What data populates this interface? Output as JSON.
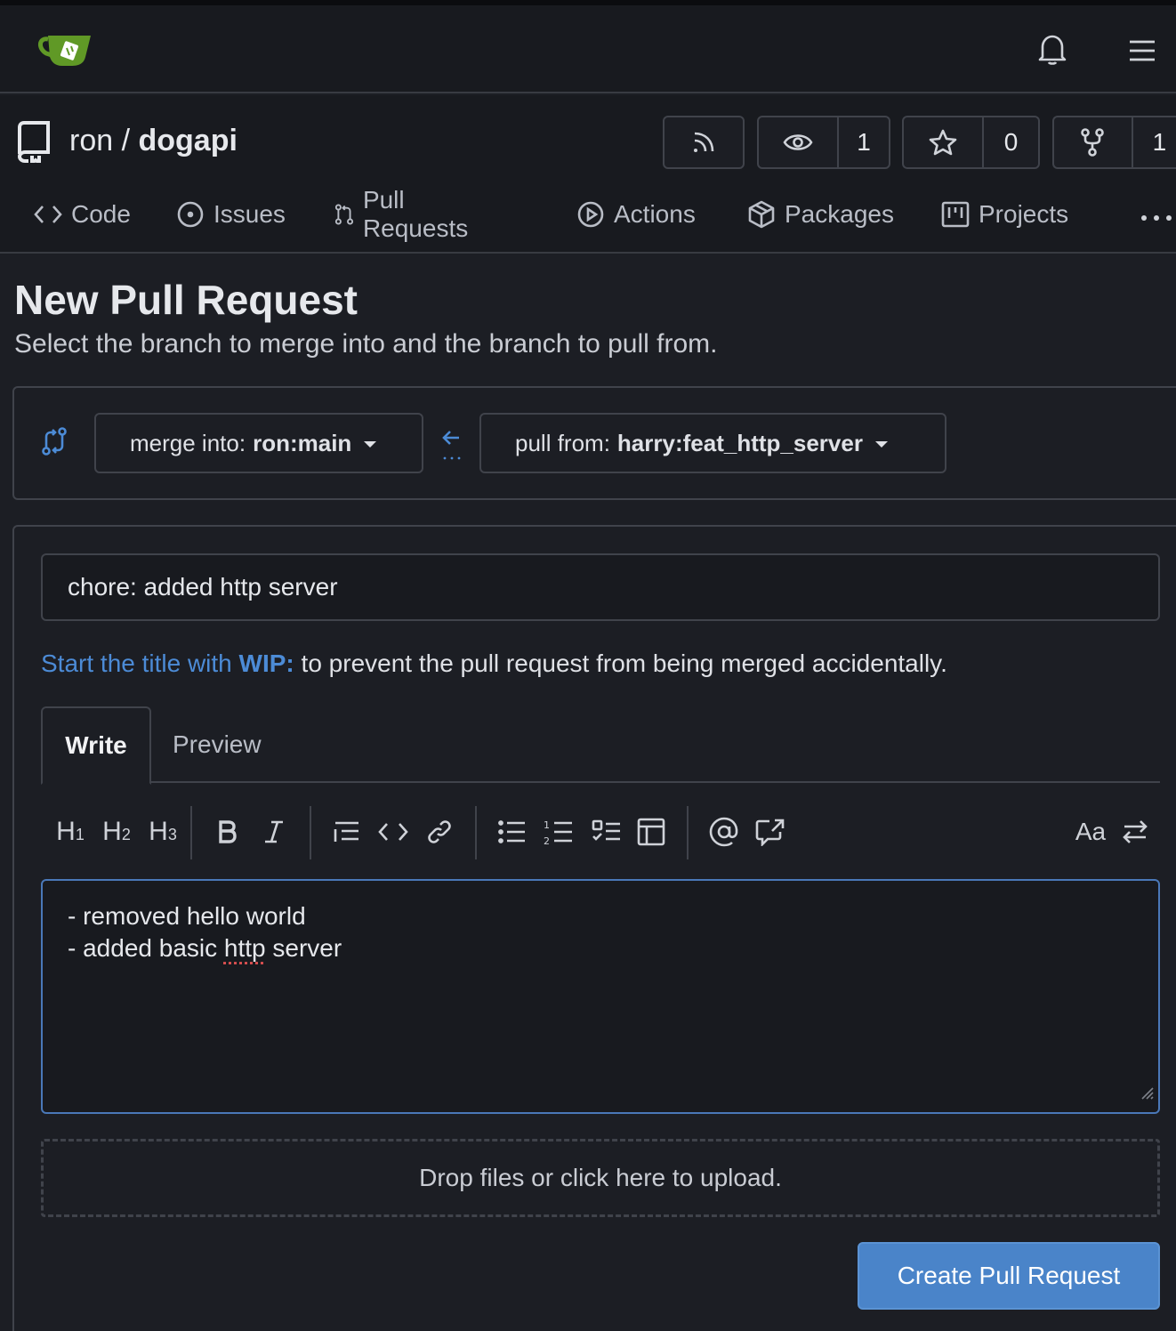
{
  "header": {
    "logo": "gitea-logo",
    "icons": [
      "bell-icon",
      "hamburger-menu-icon"
    ]
  },
  "repo": {
    "owner": "ron",
    "separator": "/",
    "name": "dogapi",
    "watch_count": "1",
    "star_count": "0",
    "fork_count": "1"
  },
  "tabs": [
    {
      "label": "Code",
      "icon": "code-icon"
    },
    {
      "label": "Issues",
      "icon": "issue-icon"
    },
    {
      "label": "Pull Requests",
      "icon": "pull-request-icon"
    },
    {
      "label": "Actions",
      "icon": "play-icon"
    },
    {
      "label": "Packages",
      "icon": "package-icon"
    },
    {
      "label": "Projects",
      "icon": "project-icon"
    }
  ],
  "page": {
    "title": "New Pull Request",
    "subtitle": "Select the branch to merge into and the branch to pull from."
  },
  "branches": {
    "merge_prefix": "merge into:",
    "merge_value": "ron:main",
    "pull_prefix": "pull from:",
    "pull_value": "harry:feat_http_server"
  },
  "form": {
    "title_value": "chore: added http server",
    "wip_link_prefix": "Start the title with",
    "wip_keyword": "WIP:",
    "wip_rest": "to prevent the pull request from being merged accidentally.",
    "tab_write": "Write",
    "tab_preview": "Preview",
    "toolbar": {
      "h1": "H",
      "h2": "H",
      "h3": "H",
      "text_size": "Aa"
    },
    "body_line1": "- removed hello world",
    "body_line2_before": "- added basic ",
    "body_line2_misspelled": "http",
    "body_line2_after": " server",
    "dropzone": "Drop files or click here to upload.",
    "submit": "Create Pull Request"
  },
  "colors": {
    "accent": "#4a84c9",
    "link": "#4c8bd6",
    "logo_green": "#609926"
  }
}
